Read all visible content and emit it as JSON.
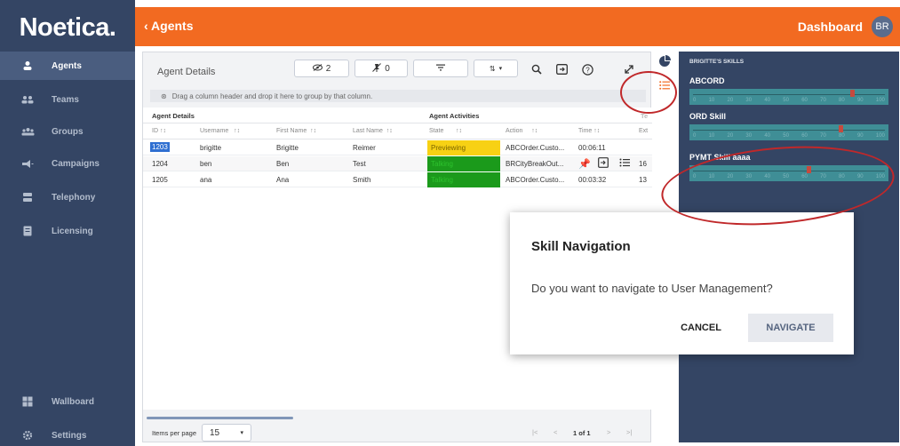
{
  "brand": {
    "logo_text": "Noetica."
  },
  "sidebar": {
    "items": [
      {
        "label": "Agents",
        "icon": "person-icon"
      },
      {
        "label": "Teams",
        "icon": "team-icon"
      },
      {
        "label": "Groups",
        "icon": "groups-icon"
      },
      {
        "label": "Campaigns",
        "icon": "megaphone-icon"
      },
      {
        "label": "Telephony",
        "icon": "telephony-icon"
      },
      {
        "label": "Licensing",
        "icon": "license-icon"
      },
      {
        "label": "Wallboard",
        "icon": "wallboard-icon"
      },
      {
        "label": "Settings",
        "icon": "gear-icon"
      }
    ]
  },
  "header": {
    "back_label": "‹ Agents",
    "dashboard_label": "Dashboard",
    "avatar_initials": "BR",
    "accent_color": "#f26a21"
  },
  "grid": {
    "title": "Agent Details",
    "hidden_count": "2",
    "pinned_count": "0",
    "group_hint": "Drag a column header and drop it here to group by that column.",
    "group_headers": {
      "details": "Agent Details",
      "activities": "Agent Activities",
      "extra": "Te"
    },
    "columns": {
      "id": "ID",
      "username": "Username",
      "first": "First Name",
      "last": "Last Name",
      "state": "State",
      "action": "Action",
      "time": "Time",
      "ext": "Ext"
    },
    "rows": [
      {
        "id": "1203",
        "username": "brigitte",
        "first": "Brigitte",
        "last": "Reimer",
        "state": "Previewing",
        "state_color": "#f7d114",
        "action": "ABCOrder.Custo...",
        "time": "00:06:11",
        "ext": ""
      },
      {
        "id": "1204",
        "username": "ben",
        "first": "Ben",
        "last": "Test",
        "state": "Talking",
        "state_color": "#1b9a1b",
        "action": "BRCityBreakOut...",
        "time": "",
        "ext": "16"
      },
      {
        "id": "1205",
        "username": "ana",
        "first": "Ana",
        "last": "Smith",
        "state": "Talking",
        "state_color": "#1b9a1b",
        "action": "ABCOrder.Custo...",
        "time": "00:03:32",
        "ext": "13"
      }
    ],
    "items_per_page_label": "Items per page",
    "items_per_page": "15",
    "page_info": "1 of 1"
  },
  "skills": {
    "title": "BRIGITTE'S SKILLS",
    "scale": [
      "0",
      "10",
      "20",
      "30",
      "40",
      "50",
      "60",
      "70",
      "80",
      "90",
      "100"
    ],
    "list": [
      {
        "name": "ABCORD",
        "level": 0.83
      },
      {
        "name": "ORD Skill",
        "level": 0.77
      },
      {
        "name": "PYMT Skill aaaa",
        "level": 0.6
      }
    ]
  },
  "dialog": {
    "title": "Skill Navigation",
    "message": "Do you want to navigate to User Management?",
    "cancel_label": "CANCEL",
    "navigate_label": "NAVIGATE"
  }
}
